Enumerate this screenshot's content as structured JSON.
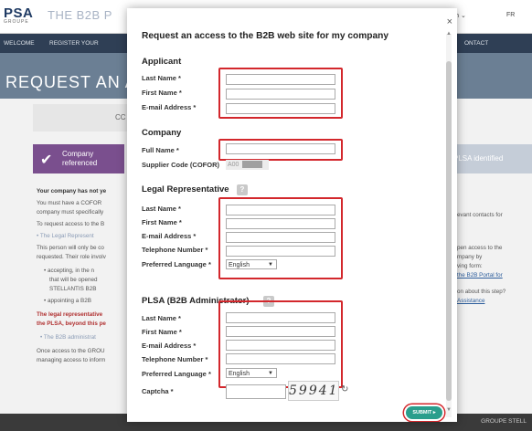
{
  "background": {
    "logo": "PSA",
    "logo_sub": "GROUPE",
    "title": "THE B2B P",
    "nav": [
      "WELCOME",
      "REGISTER YOUR",
      "ONTACT"
    ],
    "login": "Log in ⌄",
    "lang": "FR",
    "banner_title": "REQUEST AN A",
    "box_text": "CC",
    "step_left": "Company referenced",
    "step_right": "PLSA identified",
    "left_text": [
      "Your company has not ye",
      "You must have a COFOR",
      "company must specifically",
      "To request access to the B",
      "• The Legal Represent",
      "This person will only be co",
      "requested. Their role involv",
      "• accepting, in the n",
      "that will be opened",
      "STELLANTIS B2B",
      "• appointing a B2B",
      "The legal representative",
      "the PLSA, beyond this pe",
      "• The B2B administrat",
      "Once access to the GROU",
      "managing access to inform"
    ],
    "right_text": [
      "evant contacts for",
      "pen access to the",
      "mpany by",
      "ving form:",
      "the B2B Portal for",
      "on about this step?",
      "Assistance"
    ],
    "footer": "GROUPE STELL"
  },
  "modal": {
    "title": "Request an access to the B2B web site for my company",
    "applicant": {
      "heading": "Applicant",
      "last_name": "Last Name *",
      "first_name": "First Name *",
      "email": "E-mail Address *"
    },
    "company": {
      "heading": "Company",
      "full_name": "Full Name *",
      "supplier_code": "Supplier Code (COFOR)",
      "supplier_value": "A00"
    },
    "legal": {
      "heading": "Legal Representative",
      "last_name": "Last Name *",
      "first_name": "First Name *",
      "email": "E-mail Address *",
      "phone": "Telephone Number *",
      "language": "Preferred Language *",
      "language_value": "English"
    },
    "plsa": {
      "heading": "PLSA (B2B Administrator)",
      "last_name": "Last Name *",
      "first_name": "First Name *",
      "email": "E-mail Address *",
      "phone": "Telephone Number *",
      "language": "Preferred Language *",
      "language_value": "English",
      "captcha": "Captcha *",
      "captcha_value": "59941"
    },
    "submit": "SUBMIT ▸",
    "close": "×"
  }
}
